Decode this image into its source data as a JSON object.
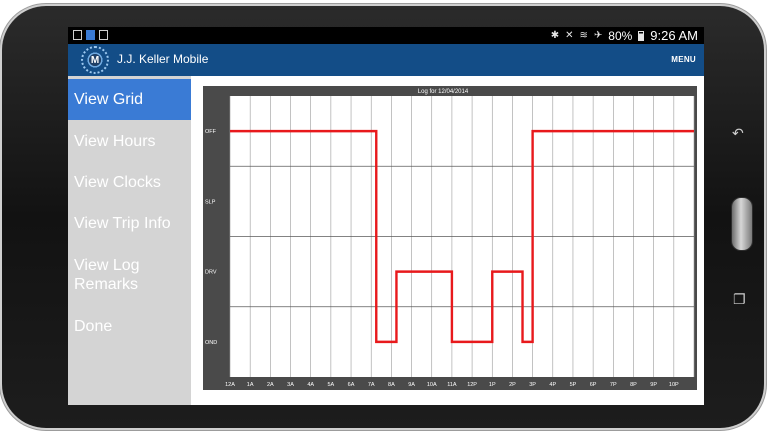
{
  "status_bar": {
    "battery": "80%",
    "time": "9:26 AM"
  },
  "app": {
    "title": "J.J. Keller Mobile",
    "menu_label": "MENU"
  },
  "sidebar": {
    "items": [
      {
        "label": "View Grid",
        "active": true
      },
      {
        "label": "View Hours",
        "active": false
      },
      {
        "label": "View Clocks",
        "active": false
      },
      {
        "label": "View Trip Info",
        "active": false
      },
      {
        "label": "View Log Remarks",
        "active": false
      },
      {
        "label": "Done",
        "active": false
      }
    ]
  },
  "colors": {
    "accent": "#3a7bd5",
    "app_bar": "#134d87",
    "line": "#e8191c",
    "chart_frame": "#4a4a4a"
  },
  "chart_data": {
    "type": "line",
    "title": "Log for 12/04/2014",
    "categories": [
      "OFF",
      "SLP",
      "DRV",
      "OND"
    ],
    "x_ticks": [
      "12A",
      "1A",
      "2A",
      "3A",
      "4A",
      "5A",
      "6A",
      "7A",
      "8A",
      "9A",
      "10A",
      "11A",
      "12P",
      "1P",
      "2P",
      "3P",
      "4P",
      "5P",
      "6P",
      "7P",
      "8P",
      "9P",
      "10P"
    ],
    "x_range": [
      0,
      23
    ],
    "x_unit": "hours",
    "step_points": [
      {
        "x": 0,
        "status": "OFF"
      },
      {
        "x": 7.25,
        "status": "OND"
      },
      {
        "x": 8.25,
        "status": "DRV"
      },
      {
        "x": 11.0,
        "status": "OND"
      },
      {
        "x": 13.0,
        "status": "DRV"
      },
      {
        "x": 14.5,
        "status": "OND"
      },
      {
        "x": 15.0,
        "status": "OFF"
      },
      {
        "x": 23,
        "status": "OFF"
      }
    ],
    "grid": true
  }
}
